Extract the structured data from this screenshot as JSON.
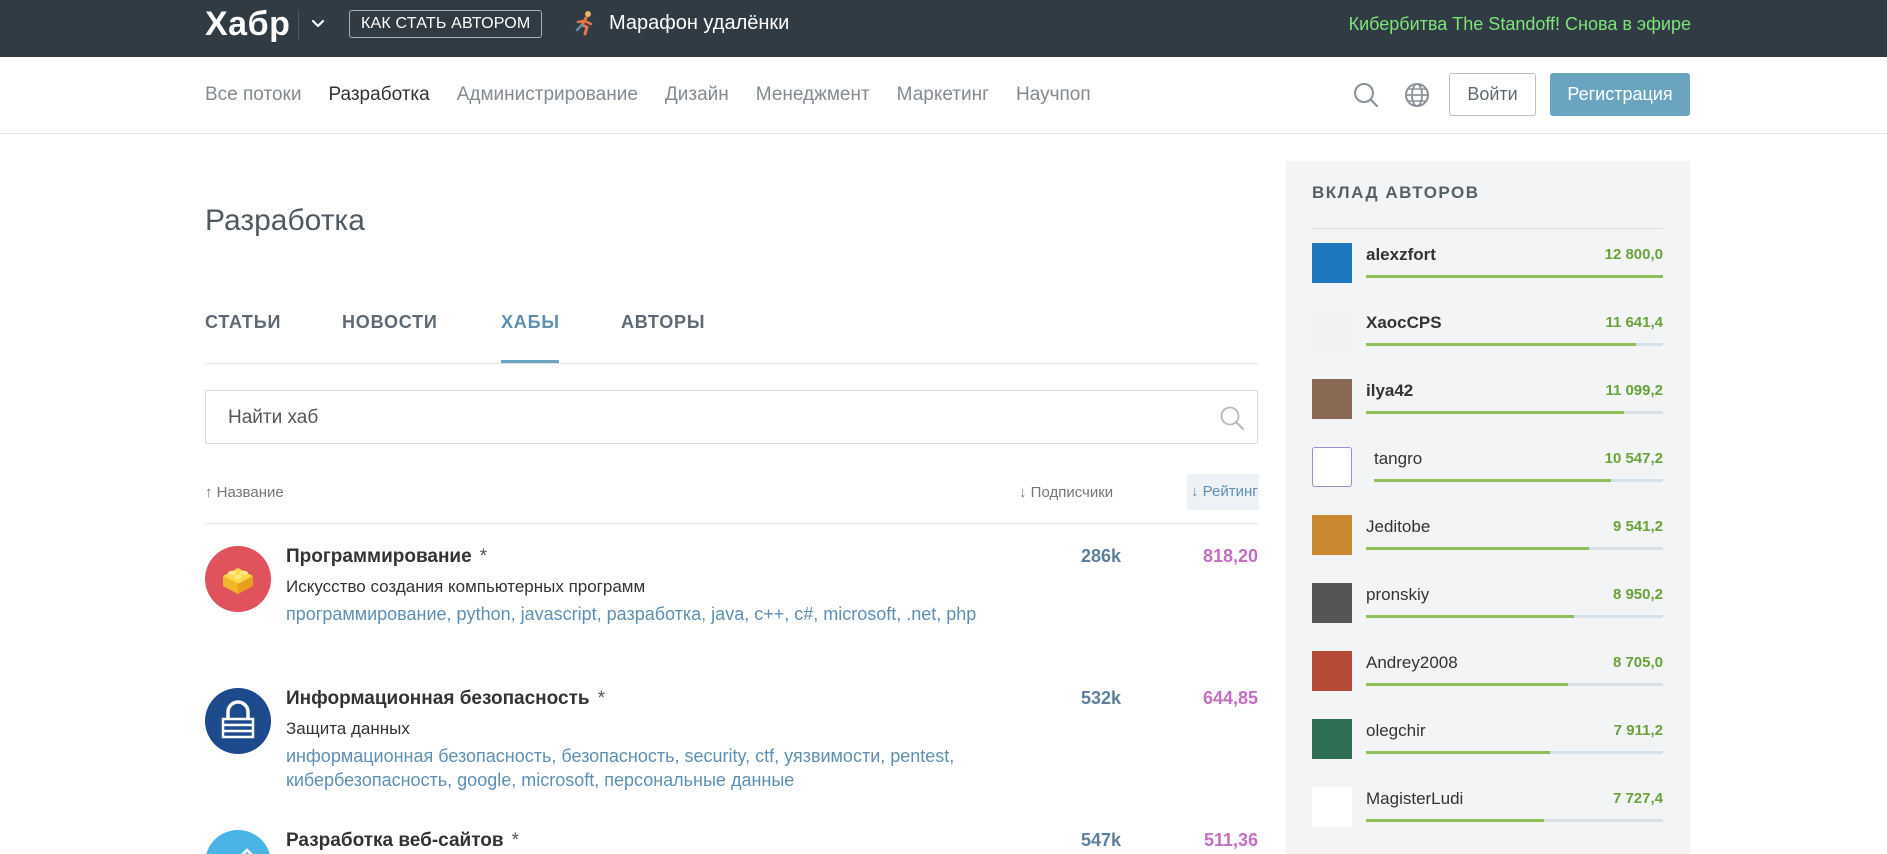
{
  "topbar": {
    "logo": "Хабр",
    "author_button": "КАК СТАТЬ АВТОРОМ",
    "marathon": "Марафон удалёнки",
    "promo": "Кибербитва The Standoff! Снова в эфире"
  },
  "nav": {
    "links": [
      "Все потоки",
      "Разработка",
      "Администрирование",
      "Дизайн",
      "Менеджмент",
      "Маркетинг",
      "Научпоп"
    ],
    "login": "Войти",
    "register": "Регистрация"
  },
  "page": {
    "title": "Разработка",
    "tabs": [
      "СТАТЬИ",
      "НОВОСТИ",
      "ХАБЫ",
      "АВТОРЫ"
    ],
    "search_placeholder": "Найти хаб",
    "sort": {
      "name": "↑ Название",
      "subscribers": "↓ Подписчики",
      "rating": "↓ Рейтинг"
    }
  },
  "hubs": [
    {
      "title": "Программирование",
      "star": "*",
      "description": "Искусство создания компьютерных программ",
      "tags": "программирование, python, javascript, разработка, java, c++, c#, microsoft, .net, php",
      "subscribers": "286k",
      "rating": "818,20",
      "icon_color": "#e0525c"
    },
    {
      "title": "Информационная безопасность",
      "star": "*",
      "description": "Защита данных",
      "tags": "информационная безопасность, безопасность, security, ctf, уязвимости, pentest, кибербезопасность, google, microsoft, персональные данные",
      "subscribers": "532k",
      "rating": "644,85",
      "icon_color": "#1d4a8c"
    },
    {
      "title": "Разработка веб-сайтов",
      "star": "*",
      "description": "",
      "tags": "",
      "subscribers": "547k",
      "rating": "511,36",
      "icon_color": "#4bb4e6"
    }
  ],
  "sidebar": {
    "title": "ВКЛАД АВТОРОВ",
    "authors": [
      {
        "name": "alexzfort",
        "score": "12 800,0",
        "fill": 1.0,
        "bold": true
      },
      {
        "name": "XaocCPS",
        "score": "11 641,4",
        "fill": 0.91,
        "bold": true
      },
      {
        "name": "ilya42",
        "score": "11 099,2",
        "fill": 0.87,
        "bold": true
      },
      {
        "name": "tangro",
        "score": "10 547,2",
        "fill": 0.82,
        "bold": false
      },
      {
        "name": "Jeditobe",
        "score": "9 541,2",
        "fill": 0.75,
        "bold": false
      },
      {
        "name": "pronskiy",
        "score": "8 950,2",
        "fill": 0.7,
        "bold": false
      },
      {
        "name": "Andrey2008",
        "score": "8 705,0",
        "fill": 0.68,
        "bold": false
      },
      {
        "name": "olegchir",
        "score": "7 911,2",
        "fill": 0.62,
        "bold": false
      },
      {
        "name": "MagisterLudi",
        "score": "7 727,4",
        "fill": 0.6,
        "bold": false
      }
    ]
  }
}
